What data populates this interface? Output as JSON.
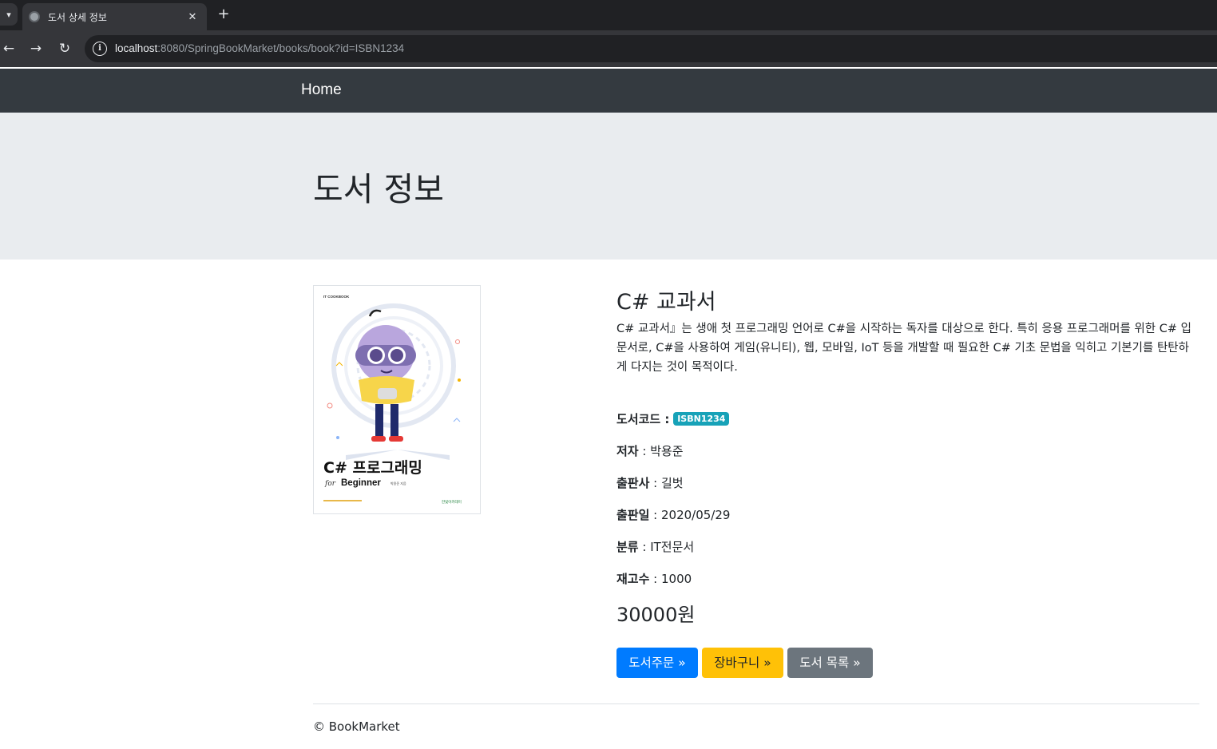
{
  "browser": {
    "tab_title": "도서 상세 정보",
    "url_host": "localhost",
    "url_rest": ":8080/SpringBookMarket/books/book?id=ISBN1234",
    "new_tab_label": "+",
    "close_label": "✕"
  },
  "navbar": {
    "brand": "Home"
  },
  "jumbotron": {
    "title": "도서 정보"
  },
  "cover": {
    "publisher_series": "IT COOKBOOK",
    "title_line1": "C# 프로그래밍",
    "title_for": "for",
    "title_beginner": "Beginner",
    "author_small": "박용준 지음",
    "imprint": "한빛아카데미"
  },
  "book": {
    "name": "C# 교과서",
    "description": "C# 교과서』는 생애 첫 프로그래밍 언어로 C#을 시작하는 독자를 대상으로 한다. 특히 응용 프로그래머를 위한 C# 입문서로, C#을 사용하여 게임(유니티), 웹, 모바일, IoT 등을 개발할 때 필요한 C# 기초 문법을 익히고 기본기를 탄탄하게 다지는 것이 목적이다.",
    "code_label": "도서코드 :",
    "code_value": "ISBN1234",
    "author_label": "저자",
    "author_value": " : 박용준",
    "publisher_label": "출판사",
    "publisher_value": " : 길벗",
    "release_label": "출판일",
    "release_value": " : 2020/05/29",
    "category_label": "분류",
    "category_value": " : IT전문서",
    "stock_label": "재고수",
    "stock_value": " : 1000",
    "price": "30000원"
  },
  "buttons": {
    "order": "도서주문 »",
    "cart": "장바구니 »",
    "list": "도서 목록 »"
  },
  "footer": {
    "text": "© BookMarket"
  },
  "colors": {
    "navbar": "#343a40",
    "jumbotron": "#e9ecef",
    "badge": "#17a2b8",
    "primary": "#007bff",
    "warning": "#ffc107",
    "secondary": "#6c757d"
  }
}
